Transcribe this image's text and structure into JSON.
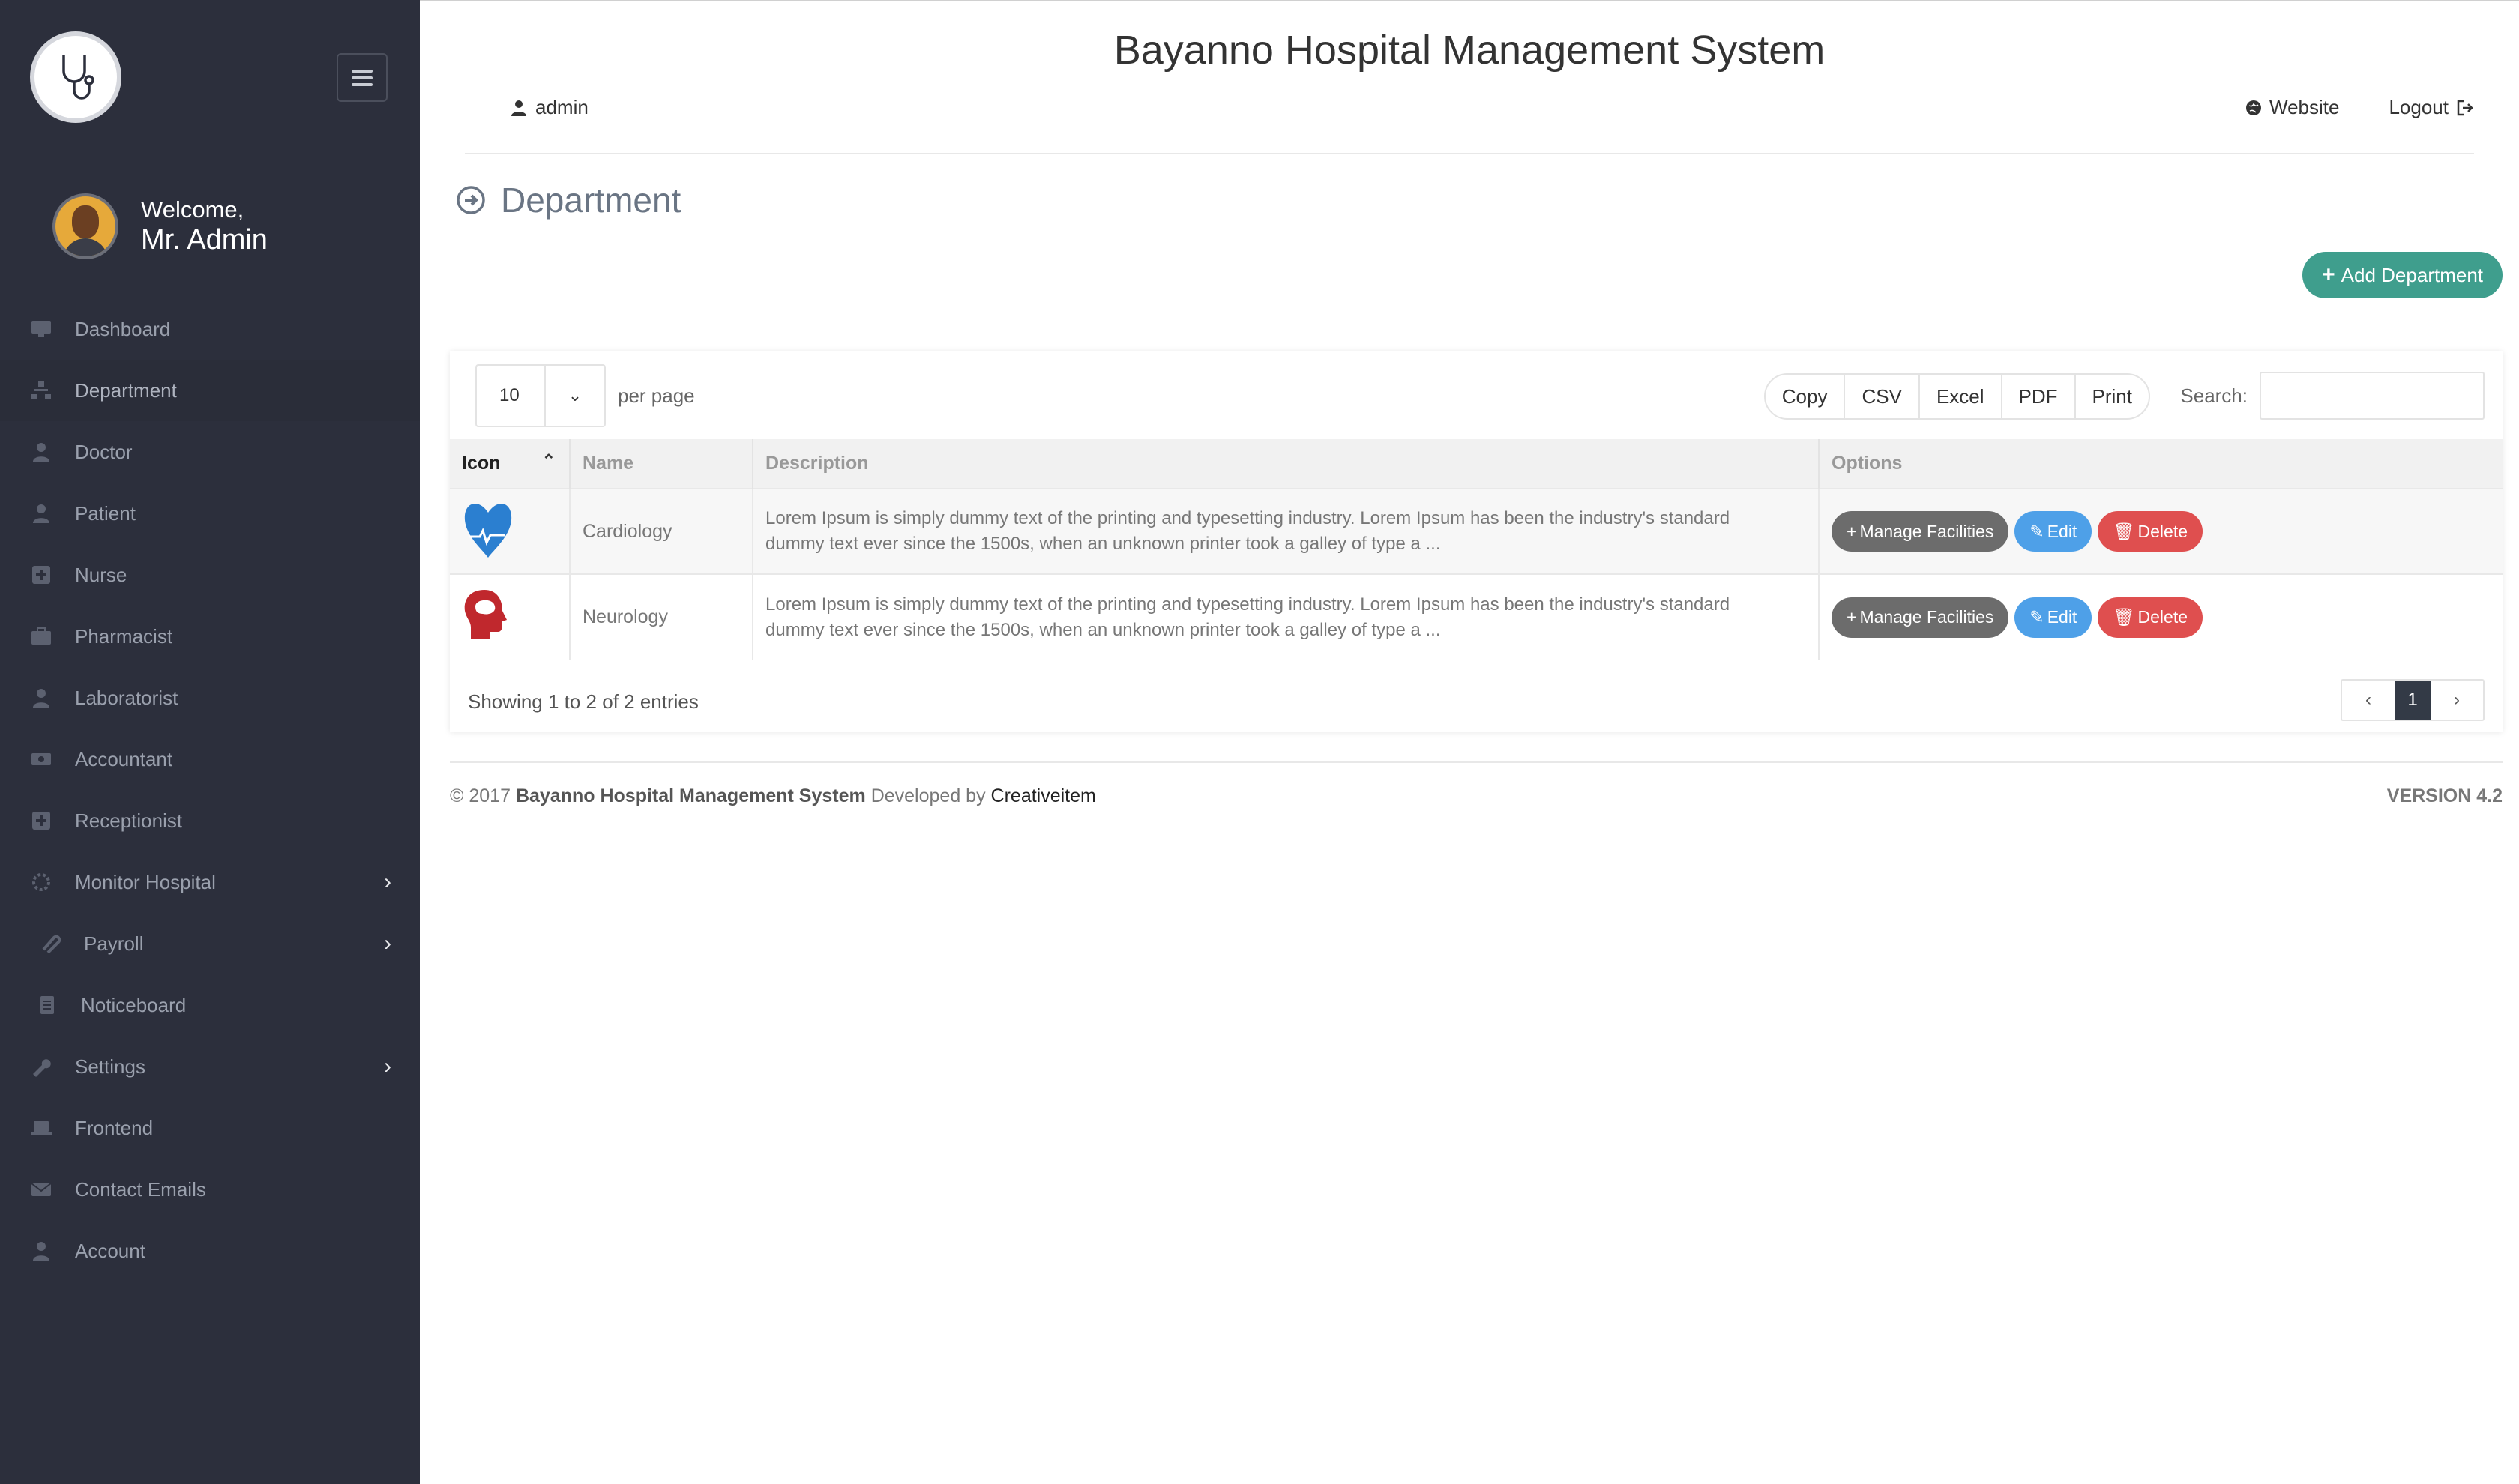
{
  "app": {
    "title": "Bayanno Hospital Management System"
  },
  "sidebar": {
    "welcome": "Welcome,",
    "user_name": "Mr. Admin",
    "items": [
      {
        "label": "Dashboard",
        "icon": "desktop-icon"
      },
      {
        "label": "Department",
        "icon": "sitemap-icon"
      },
      {
        "label": "Doctor",
        "icon": "user-md-icon"
      },
      {
        "label": "Patient",
        "icon": "user-icon"
      },
      {
        "label": "Nurse",
        "icon": "plus-square-icon"
      },
      {
        "label": "Pharmacist",
        "icon": "medkit-icon"
      },
      {
        "label": "Laboratorist",
        "icon": "user-icon"
      },
      {
        "label": "Accountant",
        "icon": "money-icon"
      },
      {
        "label": "Receptionist",
        "icon": "plus-square-icon"
      },
      {
        "label": "Monitor Hospital",
        "icon": "gear-icon"
      },
      {
        "label": "Payroll",
        "icon": "paperclip-icon"
      },
      {
        "label": "Noticeboard",
        "icon": "list-icon"
      },
      {
        "label": "Settings",
        "icon": "wrench-icon"
      },
      {
        "label": "Frontend",
        "icon": "laptop-icon"
      },
      {
        "label": "Contact Emails",
        "icon": "envelope-icon"
      },
      {
        "label": "Account",
        "icon": "user-icon"
      }
    ]
  },
  "topbar": {
    "user": "admin",
    "website": "Website",
    "logout": "Logout"
  },
  "page": {
    "title": "Department",
    "add_button": "Add Department"
  },
  "table_controls": {
    "per_page_value": "10",
    "per_page_label": "per page",
    "exports": [
      "Copy",
      "CSV",
      "Excel",
      "PDF",
      "Print"
    ],
    "search_label": "Search:"
  },
  "table": {
    "columns": [
      "Icon",
      "Name",
      "Description",
      "Options"
    ],
    "rows": [
      {
        "name": "Cardiology",
        "icon": "heart-icon",
        "icon_color": "#2b7fd0",
        "description": "Lorem Ipsum is simply dummy text of the printing and typesetting industry. Lorem Ipsum has been the industry's standard dummy text ever since the 1500s, when an unknown printer took a galley of type a ..."
      },
      {
        "name": "Neurology",
        "icon": "brain-head-icon",
        "icon_color": "#c0282d",
        "description": "Lorem Ipsum is simply dummy text of the printing and typesetting industry. Lorem Ipsum has been the industry's standard dummy text ever since the 1500s, when an unknown printer took a galley of type a ..."
      }
    ],
    "actions": {
      "manage": "Manage Facilities",
      "edit": "Edit",
      "delete": "Delete"
    },
    "info": "Showing 1 to 2 of 2 entries",
    "pagination": {
      "prev": "‹",
      "current": "1",
      "next": "›"
    }
  },
  "footer": {
    "copyright": "© 2017",
    "system": "Bayanno Hospital Management System",
    "developed_by": "Developed by",
    "developer": "Creativeitem",
    "version": "VERSION 4.2"
  },
  "colors": {
    "sidebar_bg": "#2c2f3c",
    "accent": "#3f9e8d",
    "edit": "#4ea0e8",
    "delete": "#df4f4f",
    "manage": "#6c6c6c"
  }
}
